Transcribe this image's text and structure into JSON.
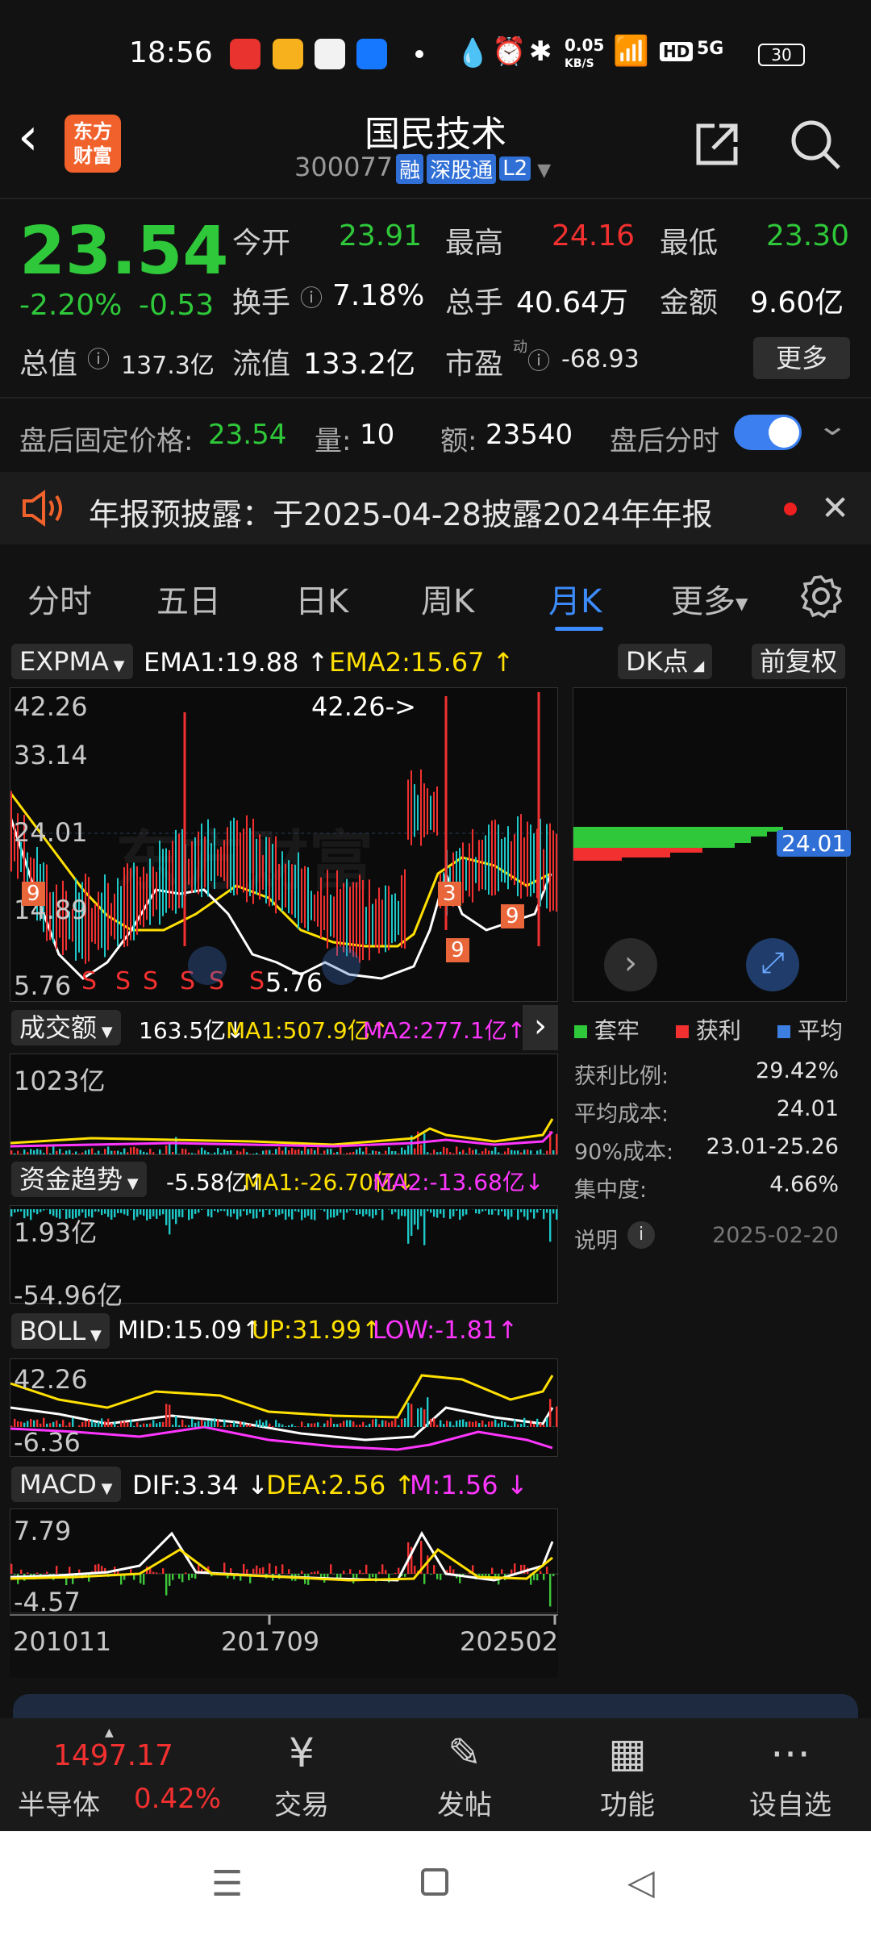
{
  "status": {
    "time": "18:56",
    "net": "0.05",
    "net_unit": "KB/S",
    "battery": "30",
    "hd": "HD",
    "sig": "5G"
  },
  "header": {
    "logo": "东方\n财富",
    "title": "国民技术",
    "code": "300077",
    "tags": [
      "融",
      "深股通",
      "L2"
    ]
  },
  "quote": {
    "price": "23.54",
    "pct": "-2.20%",
    "chg": "-0.53",
    "open_label": "今开",
    "open": "23.91",
    "high_label": "最高",
    "high": "24.16",
    "low_label": "最低",
    "low": "23.30",
    "turnover_label": "换手",
    "turnover": "7.18%",
    "volume_label": "总手",
    "volume": "40.64万",
    "amount_label": "金额",
    "amount": "9.60亿",
    "mcap_label": "总值",
    "mcap": "137.3亿",
    "float_label": "流值",
    "float": "133.2亿",
    "pe_label": "市盈",
    "pe_sup": "动",
    "pe": "-68.93",
    "more": "更多"
  },
  "afterhours": {
    "price_label": "盘后固定价格:",
    "price": "23.54",
    "vol_label": "量:",
    "vol": "10",
    "amt_label": "额:",
    "amt": "23540",
    "toggle_label": "盘后分时"
  },
  "notice": {
    "text": "年报预披露：于2025-04-28披露2024年年报"
  },
  "tabs": [
    "分时",
    "五日",
    "日K",
    "周K",
    "月K",
    "更多"
  ],
  "main_chart": {
    "indicator": "EXPMA",
    "ema1": "EMA1:19.88",
    "ema2": "EMA2:15.67",
    "dk": "DK点",
    "fq": "前复权",
    "y_labels": [
      "42.26",
      "33.14",
      "24.01",
      "14.89",
      "5.76"
    ],
    "max_note": "42.26->",
    "min_note": "5.76",
    "watermark": "东方财富"
  },
  "side_panel": {
    "price_tag": "24.01",
    "legend": [
      "套牢",
      "获利",
      "平均"
    ],
    "rows": [
      {
        "label": "获利比例:",
        "value": "29.42%"
      },
      {
        "label": "平均成本:",
        "value": "24.01"
      },
      {
        "label": "90%成本:",
        "value": "23.01-25.26"
      },
      {
        "label": "集中度:",
        "value": "4.66%"
      }
    ],
    "note_label": "说明",
    "date": "2025-02-20"
  },
  "volume_chart": {
    "indicator": "成交额",
    "val": "163.5亿",
    "ma1": "MA1:507.9亿",
    "ma2": "MA2:277.1亿",
    "y_label": "1023亿"
  },
  "fund_chart": {
    "indicator": "资金趋势",
    "val": "-5.58亿",
    "ma1": "MA1:-26.70亿",
    "ma2": "MA2:-13.68亿",
    "y_top": "1.93亿",
    "y_bottom": "-54.96亿"
  },
  "boll_chart": {
    "indicator": "BOLL",
    "mid": "MID:15.09",
    "up": "UP:31.99",
    "low": "LOW:-1.81",
    "y_top": "42.26",
    "y_bottom": "-6.36"
  },
  "macd_chart": {
    "indicator": "MACD",
    "dif": "DIF:3.34",
    "dea": "DEA:2.56",
    "m": "M:1.56",
    "y_top": "7.79",
    "y_bottom": "-4.57"
  },
  "x_axis": [
    "201011",
    "201709",
    "202502"
  ],
  "bottom": {
    "index_val": "1497.17",
    "index_name": "半导体",
    "index_pct": "0.42%",
    "items": [
      "交易",
      "发帖",
      "功能",
      "设自选"
    ]
  },
  "colors": {
    "up": "#f23030",
    "down": "#2fc83a",
    "accent": "#3d8cff"
  }
}
